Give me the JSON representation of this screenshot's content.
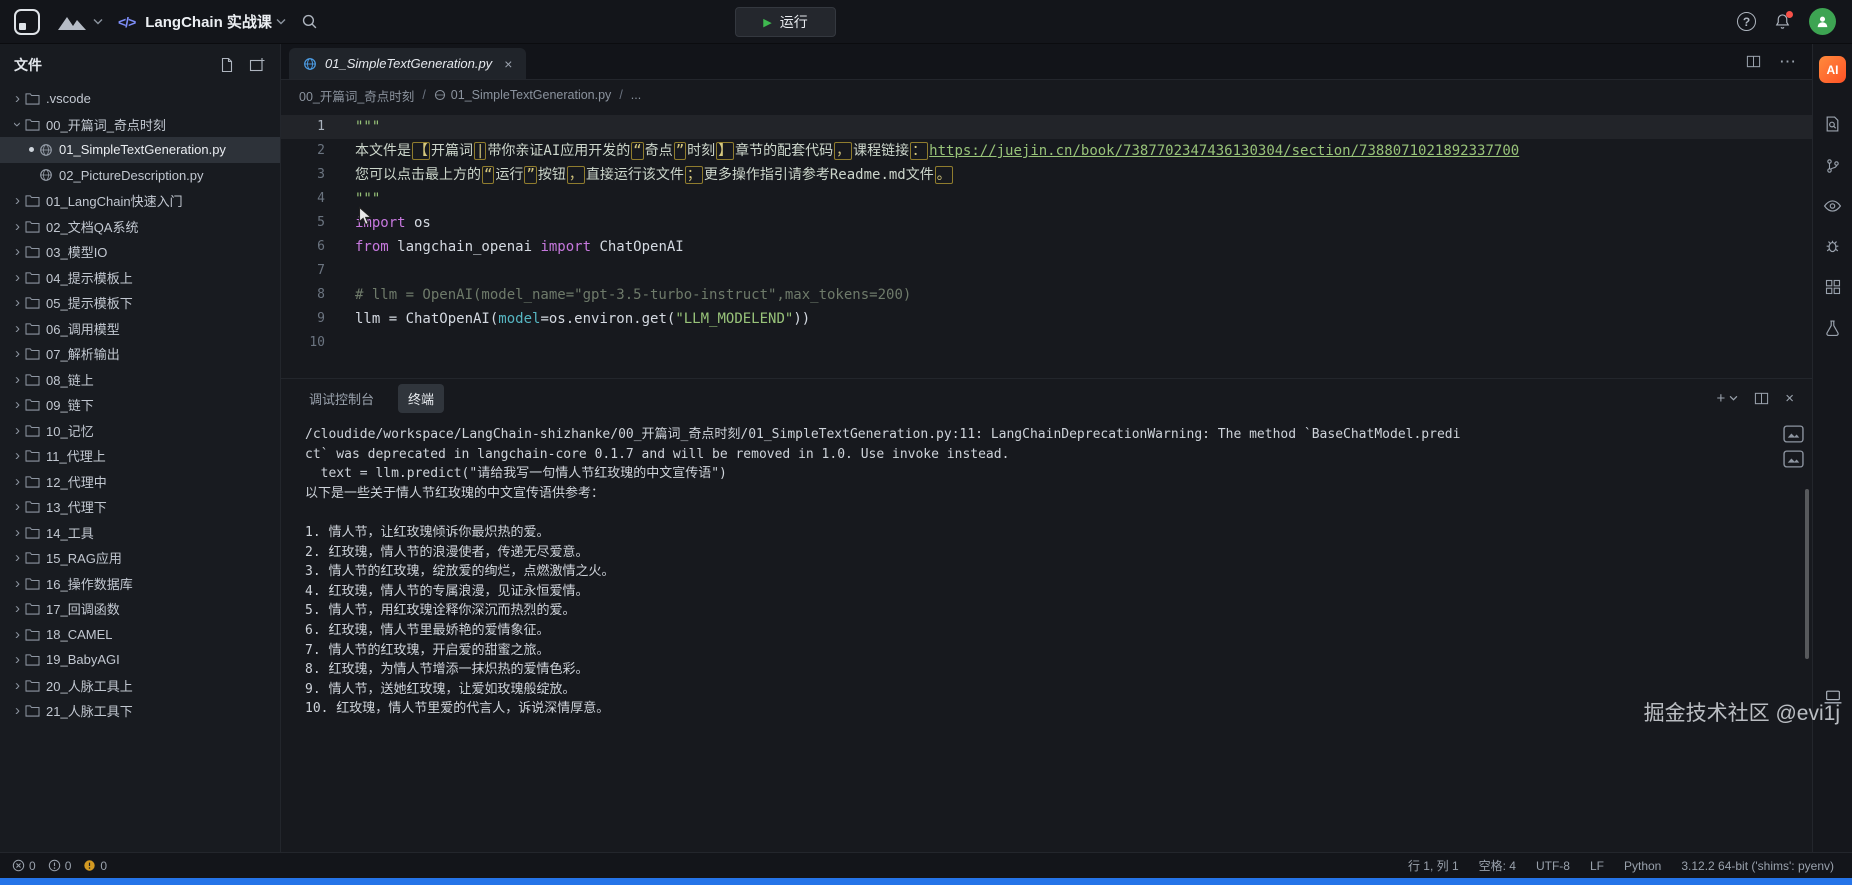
{
  "colors": {
    "accent_green": "#3fb950",
    "ai_orange": "#ff6a2b",
    "string_green": "#98c379",
    "keyword_purple": "#c678dd",
    "param_teal": "#56b6c2",
    "bottom_strip_blue": "#2574e8",
    "avatar_green": "#3da452"
  },
  "icons": {
    "play": "▶",
    "close": "×",
    "more": "⋯",
    "add": "+",
    "question": "?"
  },
  "topbar": {
    "project": "LangChain 实战课",
    "run_label": "运行"
  },
  "rightbar": {
    "ai_label": "AI"
  },
  "explorer": {
    "title": "文件",
    "tree": [
      {
        "label": ".vscode",
        "type": "folder",
        "level": 0,
        "expanded": false,
        "selected": false
      },
      {
        "label": "00_开篇词_奇点时刻",
        "type": "folder",
        "level": 0,
        "expanded": true,
        "selected": false
      },
      {
        "label": "01_SimpleTextGeneration.py",
        "type": "file",
        "level": 1,
        "selected": true
      },
      {
        "label": "02_PictureDescription.py",
        "type": "file",
        "level": 1,
        "selected": false
      },
      {
        "label": "01_LangChain快速入门",
        "type": "folder",
        "level": 0,
        "expanded": false,
        "selected": false
      },
      {
        "label": "02_文档QA系统",
        "type": "folder",
        "level": 0,
        "expanded": false,
        "selected": false
      },
      {
        "label": "03_模型IO",
        "type": "folder",
        "level": 0,
        "expanded": false,
        "selected": false
      },
      {
        "label": "04_提示模板上",
        "type": "folder",
        "level": 0,
        "expanded": false,
        "selected": false
      },
      {
        "label": "05_提示模板下",
        "type": "folder",
        "level": 0,
        "expanded": false,
        "selected": false
      },
      {
        "label": "06_调用模型",
        "type": "folder",
        "level": 0,
        "expanded": false,
        "selected": false
      },
      {
        "label": "07_解析输出",
        "type": "folder",
        "level": 0,
        "expanded": false,
        "selected": false
      },
      {
        "label": "08_链上",
        "type": "folder",
        "level": 0,
        "expanded": false,
        "selected": false
      },
      {
        "label": "09_链下",
        "type": "folder",
        "level": 0,
        "expanded": false,
        "selected": false
      },
      {
        "label": "10_记忆",
        "type": "folder",
        "level": 0,
        "expanded": false,
        "selected": false
      },
      {
        "label": "11_代理上",
        "type": "folder",
        "level": 0,
        "expanded": false,
        "selected": false
      },
      {
        "label": "12_代理中",
        "type": "folder",
        "level": 0,
        "expanded": false,
        "selected": false
      },
      {
        "label": "13_代理下",
        "type": "folder",
        "level": 0,
        "expanded": false,
        "selected": false
      },
      {
        "label": "14_工具",
        "type": "folder",
        "level": 0,
        "expanded": false,
        "selected": false
      },
      {
        "label": "15_RAG应用",
        "type": "folder",
        "level": 0,
        "expanded": false,
        "selected": false
      },
      {
        "label": "16_操作数据库",
        "type": "folder",
        "level": 0,
        "expanded": false,
        "selected": false
      },
      {
        "label": "17_回调函数",
        "type": "folder",
        "level": 0,
        "expanded": false,
        "selected": false
      },
      {
        "label": "18_CAMEL",
        "type": "folder",
        "level": 0,
        "expanded": false,
        "selected": false
      },
      {
        "label": "19_BabyAGI",
        "type": "folder",
        "level": 0,
        "expanded": false,
        "selected": false
      },
      {
        "label": "20_人脉工具上",
        "type": "folder",
        "level": 0,
        "expanded": false,
        "selected": false
      },
      {
        "label": "21_人脉工具下",
        "type": "folder",
        "level": 0,
        "expanded": false,
        "selected": false
      }
    ]
  },
  "editor": {
    "tab": "01_SimpleTextGeneration.py",
    "breadcrumb": [
      "00_开篇词_奇点时刻",
      "01_SimpleTextGeneration.py",
      "..."
    ],
    "cursor": "行 1, 列 1",
    "code": [
      [
        {
          "t": "\"\"\"",
          "c": "q"
        }
      ],
      [
        {
          "t": "本文件是",
          "c": "b"
        },
        {
          "t": "【",
          "c": "x"
        },
        {
          "t": "开篇词",
          "c": "b"
        },
        {
          "t": "|",
          "c": "x"
        },
        {
          "t": "带你亲证AI应用开发的",
          "c": "b"
        },
        {
          "t": "“",
          "c": "x"
        },
        {
          "t": "奇点",
          "c": "b"
        },
        {
          "t": "”",
          "c": "x"
        },
        {
          "t": "时刻",
          "c": "b"
        },
        {
          "t": "】",
          "c": "x"
        },
        {
          "t": "章节的配套代码",
          "c": "b"
        },
        {
          "t": "，",
          "c": "x"
        },
        {
          "t": "课程链接",
          "c": "b"
        },
        {
          "t": "：",
          "c": "x"
        },
        {
          "t": "https://juejin.cn/book/7387702347436130304/section/7388071021892337700",
          "c": "l"
        }
      ],
      [
        {
          "t": "您可以点击最上方的",
          "c": "b"
        },
        {
          "t": "“",
          "c": "x"
        },
        {
          "t": "运行",
          "c": "b"
        },
        {
          "t": "”",
          "c": "x"
        },
        {
          "t": "按钮",
          "c": "b"
        },
        {
          "t": "，",
          "c": "x"
        },
        {
          "t": "直接运行该文件",
          "c": "b"
        },
        {
          "t": "；",
          "c": "x"
        },
        {
          "t": "更多操作指引请参考Readme.md文件",
          "c": "b"
        },
        {
          "t": "。",
          "c": "x"
        }
      ],
      [
        {
          "t": "\"\"\"",
          "c": "q"
        }
      ],
      [
        {
          "t": "import",
          "c": "k"
        },
        {
          "t": " os",
          "c": "p"
        }
      ],
      [
        {
          "t": "from",
          "c": "k"
        },
        {
          "t": " langchain_openai ",
          "c": "p"
        },
        {
          "t": "import",
          "c": "k"
        },
        {
          "t": " ChatOpenAI",
          "c": "p"
        }
      ],
      [],
      [
        {
          "t": "# llm = OpenAI(model_name=\"gpt-3.5-turbo-instruct\",max_tokens=200)",
          "c": "c"
        }
      ],
      [
        {
          "t": "llm = ChatOpenAI(",
          "c": "p"
        },
        {
          "t": "model",
          "c": "a"
        },
        {
          "t": "=os.environ.get(",
          "c": "p"
        },
        {
          "t": "\"LLM_MODELEND\"",
          "c": "s"
        },
        {
          "t": "))",
          "c": "p"
        }
      ],
      []
    ]
  },
  "panel": {
    "tabs": [
      {
        "label": "调试控制台",
        "active": false
      },
      {
        "label": "终端",
        "active": true
      }
    ],
    "terminal_lines": [
      "/cloudide/workspace/LangChain-shizhanke/00_开篇词_奇点时刻/01_SimpleTextGeneration.py:11: LangChainDeprecationWarning: The method `BaseChatModel.predi",
      "ct` was deprecated in langchain-core 0.1.7 and will be removed in 1.0. Use invoke instead.",
      "  text = llm.predict(\"请给我写一句情人节红玫瑰的中文宣传语\")",
      "以下是一些关于情人节红玫瑰的中文宣传语供参考：",
      "",
      "1. 情人节，让红玫瑰倾诉你最炽热的爱。",
      "2. 红玫瑰，情人节的浪漫使者，传递无尽爱意。",
      "3. 情人节的红玫瑰，绽放爱的绚烂，点燃激情之火。",
      "4. 红玫瑰，情人节的专属浪漫，见证永恒爱情。",
      "5. 情人节，用红玫瑰诠释你深沉而热烈的爱。",
      "6. 红玫瑰，情人节里最娇艳的爱情象征。",
      "7. 情人节的红玫瑰，开启爱的甜蜜之旅。",
      "8. 红玫瑰，为情人节增添一抹炽热的爱情色彩。",
      "9. 情人节，送她红玫瑰，让爱如玫瑰般绽放。",
      "10. 红玫瑰，情人节里爱的代言人，诉说深情厚意。"
    ]
  },
  "statusbar": {
    "problems": [
      {
        "name": "errors",
        "count": "0"
      },
      {
        "name": "warnings",
        "count": "0"
      },
      {
        "name": "notifications",
        "count": "0"
      }
    ],
    "right": [
      "行 1, 列 1",
      "空格: 4",
      "UTF-8",
      "LF",
      "Python",
      "3.12.2 64-bit ('shims': pyenv)"
    ]
  },
  "watermark": "掘金技术社区 @evi1j"
}
